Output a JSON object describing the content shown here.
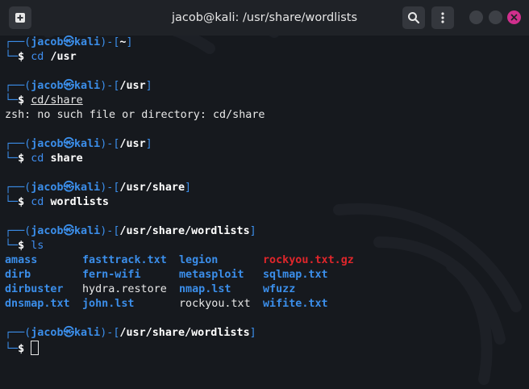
{
  "window": {
    "title": "jacob@kali: /usr/share/wordlists"
  },
  "titlebar": {
    "new_tab_icon": "new-tab-icon",
    "search_icon": "search-icon",
    "menu_icon": "kebab-menu-icon",
    "close_color": "#d02f8d"
  },
  "prompt": {
    "corner_top": "┌──(",
    "user": "jacob",
    "at_symbol": "㉿",
    "host": "kali",
    "sep": ")-[",
    "close": "]",
    "corner_bottom": "└─",
    "dollar": "$"
  },
  "blocks": [
    {
      "path": "~",
      "cmd": "cd",
      "arg": "/usr"
    },
    {
      "path": "/usr",
      "cmd_underlined": "cd/share",
      "output": "zsh: no such file or directory: cd/share"
    },
    {
      "path": "/usr",
      "cmd": "cd",
      "arg": "share"
    },
    {
      "path": "/usr/share",
      "cmd": "cd",
      "arg": "wordlists"
    },
    {
      "path": "/usr/share/wordlists",
      "cmd": "ls"
    },
    {
      "path": "/usr/share/wordlists"
    }
  ],
  "ls_output": [
    [
      "amass",
      "fasttrack.txt",
      "legion",
      "rockyou.txt.gz"
    ],
    [
      "dirb",
      "fern-wifi",
      "metasploit",
      "sqlmap.txt"
    ],
    [
      "dirbuster",
      "hydra.restore",
      "nmap.lst",
      "wfuzz"
    ],
    [
      "dnsmap.txt",
      "john.lst",
      "rockyou.txt",
      "wifite.txt"
    ]
  ],
  "colors": {
    "prompt_blue": "#3b8eea",
    "archive_red": "#e0262b",
    "background": "#16191e"
  }
}
